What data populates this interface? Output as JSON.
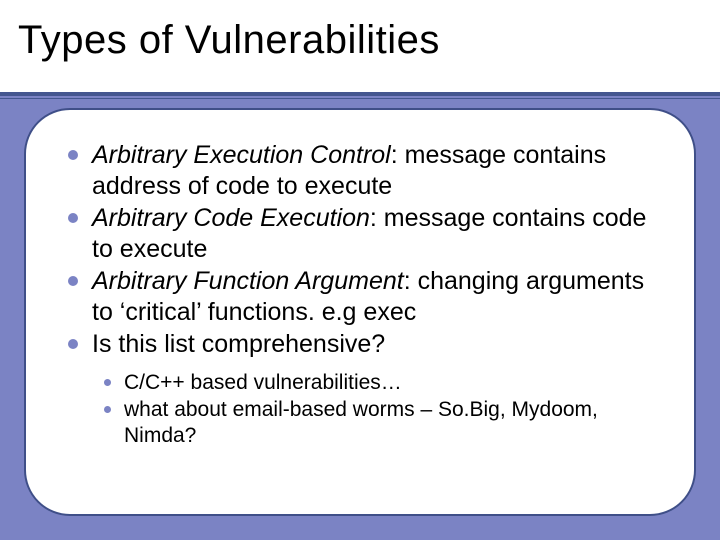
{
  "title": "Types of Vulnerabilities",
  "bullets": [
    {
      "term": "Arbitrary Execution Control",
      "desc": ": message contains address of code to execute"
    },
    {
      "term": "Arbitrary Code Execution",
      "desc": ": message contains code to execute"
    },
    {
      "term": "Arbitrary Function Argument",
      "desc": ": changing arguments to ‘critical’ functions. e.g exec"
    },
    {
      "term": "",
      "desc": "Is this list comprehensive?"
    }
  ],
  "sub_bullets": [
    "C/C++ based vulnerabilities…",
    "what about email-based worms – So.Big, Mydoom, Nimda?"
  ],
  "colors": {
    "periwinkle": "#7b83c4",
    "rule": "#44568f"
  }
}
